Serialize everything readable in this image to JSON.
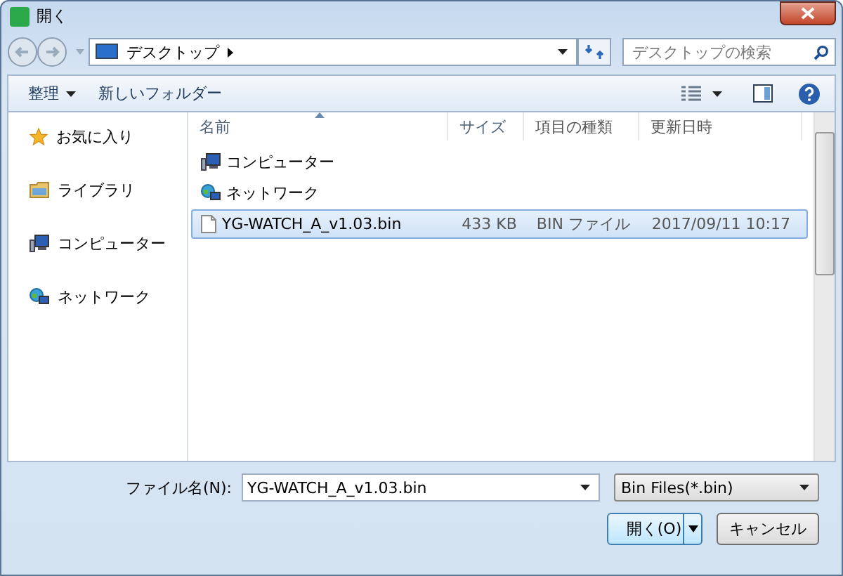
{
  "window": {
    "title": "開く"
  },
  "address": {
    "location": "デスクトップ"
  },
  "search": {
    "placeholder": "デスクトップの検索"
  },
  "toolbar": {
    "organize": "整理",
    "new_folder": "新しいフォルダー"
  },
  "sidebar": {
    "items": [
      {
        "label": "お気に入り",
        "kind": "favorites"
      },
      {
        "label": "ライブラリ",
        "kind": "library"
      },
      {
        "label": "コンピューター",
        "kind": "computer"
      },
      {
        "label": "ネットワーク",
        "kind": "network"
      }
    ]
  },
  "table": {
    "columns": [
      "名前",
      "サイズ",
      "項目の種類",
      "更新日時"
    ],
    "rows": [
      {
        "kind": "computer",
        "name": "コンピューター",
        "selected": false
      },
      {
        "kind": "network",
        "name": "ネットワーク",
        "selected": false
      },
      {
        "kind": "file",
        "name": "YG-WATCH_A_v1.03.bin",
        "size": "433 KB",
        "type": "BIN ファイル",
        "modified": "2017/09/11 10:17",
        "selected": true
      }
    ]
  },
  "footer": {
    "filename_label": "ファイル名(N):",
    "filename": "YG-WATCH_A_v1.03.bin",
    "filter": "Bin Files(*.bin)",
    "open": "開く(O)",
    "cancel": "キャンセル"
  }
}
